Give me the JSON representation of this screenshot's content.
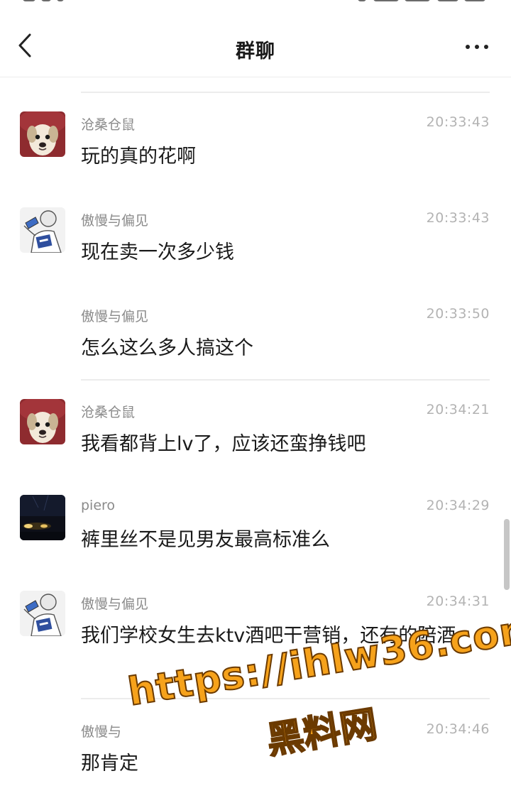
{
  "header": {
    "title": "群聊",
    "back_icon": "chevron-left-icon",
    "more_icon": "more-dots-icon"
  },
  "messages": [
    {
      "sender": "沧桑仓鼠",
      "time": "20:33:43",
      "text": "玩的真的花啊",
      "avatar": "dog-avatar"
    },
    {
      "sender": "傲慢与偏见",
      "time": "20:33:43",
      "text": "现在卖一次多少钱",
      "avatar": "sketch-avatar"
    },
    {
      "sender": "傲慢与偏见",
      "time": "20:33:50",
      "text": "怎么这么多人搞这个",
      "avatar": ""
    },
    {
      "sender": "沧桑仓鼠",
      "time": "20:34:21",
      "text": "我看都背上lv了，应该还蛮挣钱吧",
      "avatar": "dog-avatar"
    },
    {
      "sender": "piero",
      "time": "20:34:29",
      "text": "裤里丝不是见男友最高标准么",
      "avatar": "night-car-avatar"
    },
    {
      "sender": "傲慢与偏见",
      "time": "20:34:31",
      "text": "我们学校女生去ktv酒吧干营销，还有的陪酒",
      "avatar": "sketch-avatar"
    },
    {
      "sender": "傲慢与",
      "time": "20:34:46",
      "text": "那肯定",
      "avatar": ""
    }
  ],
  "watermark": {
    "url": "https://ihlw36.com",
    "label": "黑料网"
  },
  "colors": {
    "background": "#ffffff",
    "sender_text": "#8a8a8a",
    "time_text": "#b3b3b3",
    "message_text": "#1a1a1a",
    "watermark_fill": "#f6a21b"
  }
}
